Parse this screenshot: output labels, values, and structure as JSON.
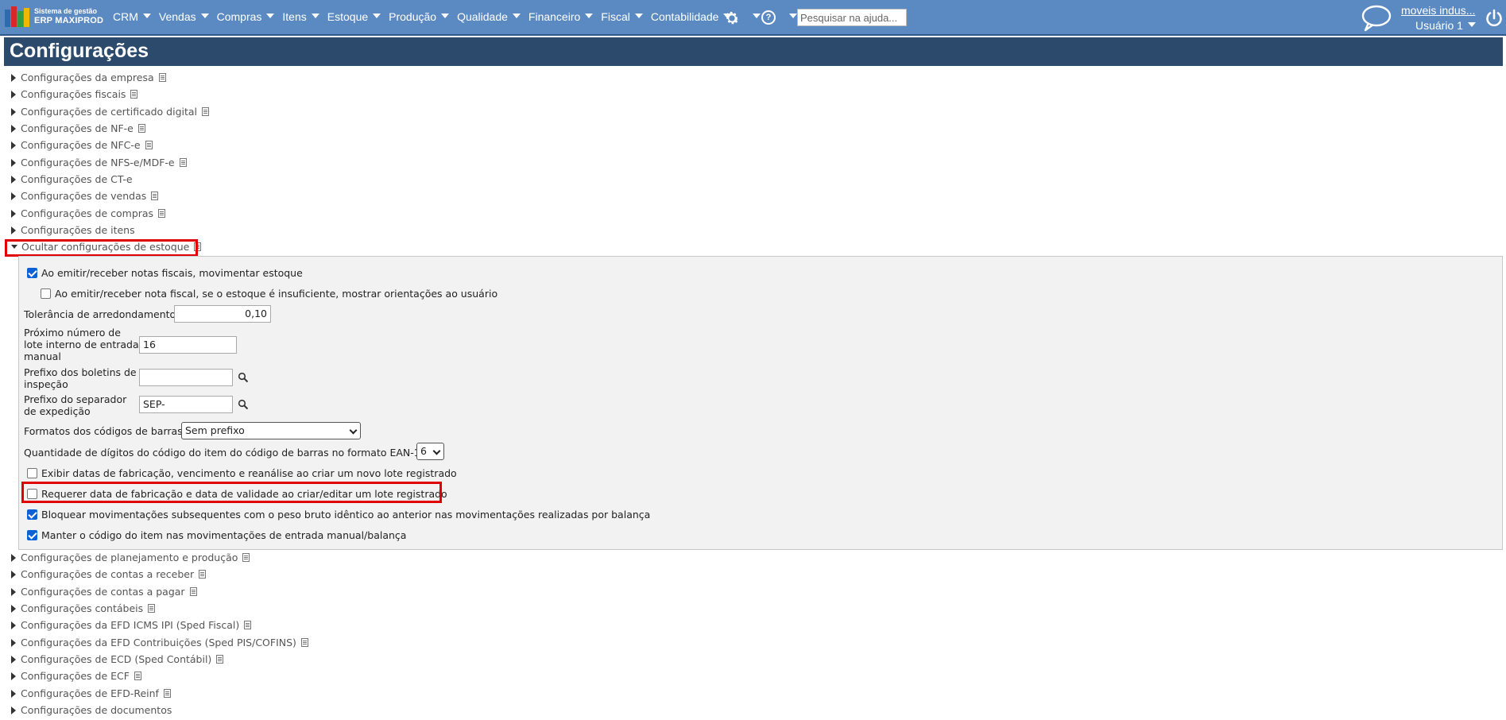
{
  "header": {
    "logo_line1": "Sistema de gestão",
    "logo_line2": "ERP MAXIPROD",
    "menu": [
      "CRM",
      "Vendas",
      "Compras",
      "Itens",
      "Estoque",
      "Produção",
      "Qualidade",
      "Financeiro",
      "Fiscal",
      "Contabilidade"
    ],
    "help_glyph": "?",
    "search_placeholder": "Pesquisar na ajuda...",
    "company": "moveis indus...",
    "user": "Usuário 1"
  },
  "page": {
    "title": "Configurações"
  },
  "sections_top": [
    {
      "label": "Configurações da empresa",
      "doc": true
    },
    {
      "label": "Configurações fiscais",
      "doc": true
    },
    {
      "label": "Configurações de certificado digital",
      "doc": true
    },
    {
      "label": "Configurações de NF-e",
      "doc": true
    },
    {
      "label": "Configurações de NFC-e",
      "doc": true
    },
    {
      "label": "Configurações de NFS-e/MDF-e",
      "doc": true
    },
    {
      "label": "Configurações de CT-e",
      "doc": false
    },
    {
      "label": "Configurações de vendas",
      "doc": true
    },
    {
      "label": "Configurações de compras",
      "doc": true
    },
    {
      "label": "Configurações de itens",
      "doc": false
    }
  ],
  "expanded_section": {
    "label": "Ocultar configurações de estoque"
  },
  "stock": {
    "emit_move_stock": {
      "label": "Ao emitir/receber notas fiscais, movimentar estoque",
      "checked": true
    },
    "insufficient_stock_guidance": {
      "label": "Ao emitir/receber nota fiscal, se o estoque é insuficiente, mostrar orientações ao usuário",
      "checked": false
    },
    "rounding_tolerance": {
      "label": "Tolerância de arredondamento",
      "value": "0,10"
    },
    "next_lot_number": {
      "label_lines": [
        "Próximo número de",
        "lote interno de entrada",
        "manual"
      ],
      "value": "16"
    },
    "inspection_prefix": {
      "label_lines": [
        "Prefixo dos boletins de",
        "inspeção"
      ],
      "value": ""
    },
    "separator_prefix": {
      "label_lines": [
        "Prefixo do separador",
        "de expedição"
      ],
      "value": "SEP-"
    },
    "barcode_formats": {
      "label": "Formatos dos códigos de barras",
      "value": "Sem prefixo"
    },
    "ean13_digits": {
      "label": "Quantidade de dígitos do código do item do código de barras no formato EAN-13",
      "value": "6"
    },
    "show_dates_new_lot": {
      "label": "Exibir datas de fabricação, vencimento e reanálise ao criar um novo lote registrado",
      "checked": false
    },
    "require_dates_lot": {
      "label": "Requerer data de fabricação e data de validade ao criar/editar um lote registrado",
      "checked": false
    },
    "block_same_weight": {
      "label": "Bloquear movimentações subsequentes com o peso bruto idêntico ao anterior nas movimentações realizadas por balança",
      "checked": true
    },
    "keep_item_code": {
      "label": "Manter o código do item nas movimentações de entrada manual/balança",
      "checked": true
    }
  },
  "sections_bottom": [
    {
      "label": "Configurações de planejamento e produção",
      "doc": true
    },
    {
      "label": "Configurações de contas a receber",
      "doc": true
    },
    {
      "label": "Configurações de contas a pagar",
      "doc": true
    },
    {
      "label": "Configurações contábeis",
      "doc": true
    },
    {
      "label": "Configurações da EFD ICMS IPI (Sped Fiscal)",
      "doc": true
    },
    {
      "label": "Configurações da EFD Contribuições (Sped PIS/COFINS)",
      "doc": true
    },
    {
      "label": "Configurações de ECD (Sped Contábil)",
      "doc": true
    },
    {
      "label": "Configurações de ECF",
      "doc": true
    },
    {
      "label": "Configurações de EFD-Reinf",
      "doc": true
    },
    {
      "label": "Configurações de documentos",
      "doc": false
    }
  ],
  "colors": {
    "topbar": "#5b8ac2",
    "title_bar": "#2c4a6b",
    "highlight": "#e00000",
    "checkbox_checked": "#0a63d6"
  }
}
